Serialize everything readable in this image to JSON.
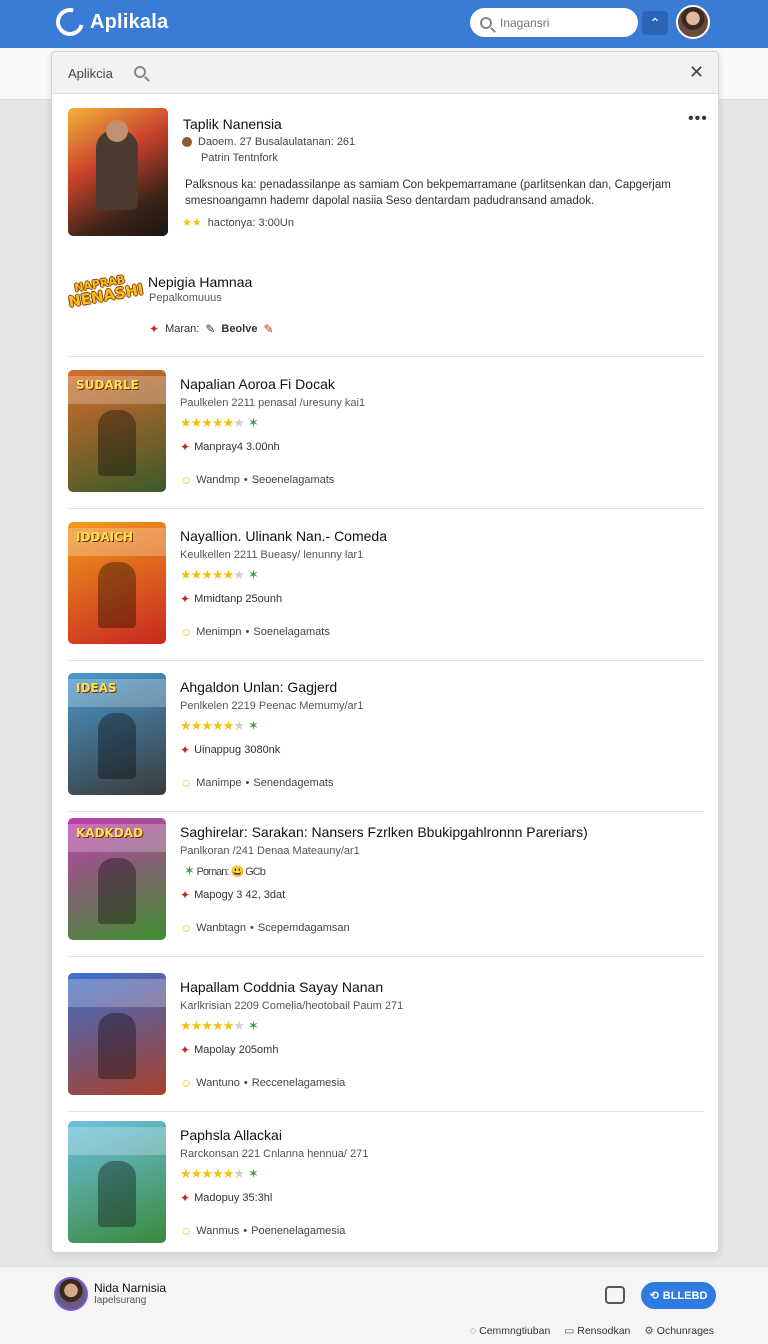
{
  "topbar": {
    "app_name": "Aplikala",
    "search_placeholder": "Inagansri",
    "chevron": "⌃"
  },
  "panel": {
    "title": "Aplikcia",
    "close": "✕",
    "featured": {
      "title": "Taplik Nanensia",
      "more": "•••",
      "meta1": "Daoem.  27  Busalaulatanan: 261",
      "meta2": "Patrin Tentnfork",
      "description": "Palksnous ka: penadassilanpe as samiam Con bekpemarramane (parlitsenkan  dan,  Capgerjam smesnoangamn hademr dapolal nasiia Seso dentardam padudransand amadok.",
      "rating": "hactonya: 3:00Un",
      "rating_stars": "★★"
    },
    "publisher": {
      "logo_line1": "NAPRAB",
      "logo_line2": "NENASHI",
      "name": "Nepigia Hamnaa",
      "subtitle": "Pepalkomuuus",
      "action1": "Maran:",
      "action2": "Beolve"
    },
    "apps": [
      {
        "title": "Napalian Aoroa Fi Docak",
        "subtitle": "Paulkelen 2211 penasal /uresuny kai1",
        "rating": 4.5,
        "price": "Manpray4 3.00nh",
        "footer_left": "Wandmp",
        "footer_right": "Seoenelagamats",
        "thumb_caption": "SUDARLE",
        "color_a": "#d96b2b",
        "color_b": "#3a5a2a"
      },
      {
        "title": "Nayallion. Ulinank Nan.- Comeda",
        "subtitle": "Keulkellen 2211 Bueasy/ lenunny lar1",
        "rating": 4.5,
        "price": "Mmidtanp 25ounh",
        "footer_left": "Menimpn",
        "footer_right": "Soenelagamats",
        "thumb_caption": "IDDAICH",
        "color_a": "#f29b1d",
        "color_b": "#c8281f"
      },
      {
        "title": "Ahgaldon Unlan: Gagjerd",
        "subtitle": "Penlkelen 2219 Peenac Memumy/ar1",
        "rating": 4.5,
        "price": "Uinappug 3080nk",
        "footer_left": "Manimpe",
        "footer_right": "Senendagemats",
        "thumb_caption": "IDEAS",
        "color_a": "#4a9ad0",
        "color_b": "#3a3a3a"
      },
      {
        "title": "Saghirelar: Sarakan: Nansers Fzrlken Bbukipgahlronnn Pareriars)",
        "subtitle": "Panlkoran /241 Denaa Mateauny/ar1",
        "rating": 0,
        "rating_text": "Poman:  😃  GCb",
        "price": "Mapogy 3 42, 3dat",
        "footer_left": "Wanbtagn",
        "footer_right": "Scepemdagamsan",
        "thumb_caption": "KADKDAD",
        "color_a": "#c13bb0",
        "color_b": "#3e8f2e"
      },
      {
        "title": "Hapallam Coddnia  Sayay Nanan",
        "subtitle": "Karlkrisian 2209 Comelia/heotobail Paum 271",
        "rating": 4.5,
        "price": "Mapolay 205omh",
        "footer_left": "Wantuno",
        "footer_right": "Reccenelagamesia",
        "thumb_caption": "",
        "color_a": "#3b6fd0",
        "color_b": "#a8402a"
      },
      {
        "title": "Paphsla Allackai",
        "subtitle": "Rarckonsan 221 Cnlanna hennua/ 271",
        "rating": 4.5,
        "price": "Madopuy 35:3hl",
        "footer_left": "Wanmus",
        "footer_right": "Poenenelagamesia",
        "thumb_caption": "",
        "color_a": "#6ec0e6",
        "color_b": "#3a8a3a"
      }
    ]
  },
  "bottom": {
    "user_name": "Nida Narnisia",
    "user_sub": "Iapelsurang",
    "primary_label": "BLLEBD",
    "links": [
      {
        "icon": "chat-icon",
        "label": "Cemmngtiuban"
      },
      {
        "icon": "window-icon",
        "label": "Rensodkan"
      },
      {
        "icon": "settings-icon",
        "label": "Ochunrages"
      }
    ]
  }
}
